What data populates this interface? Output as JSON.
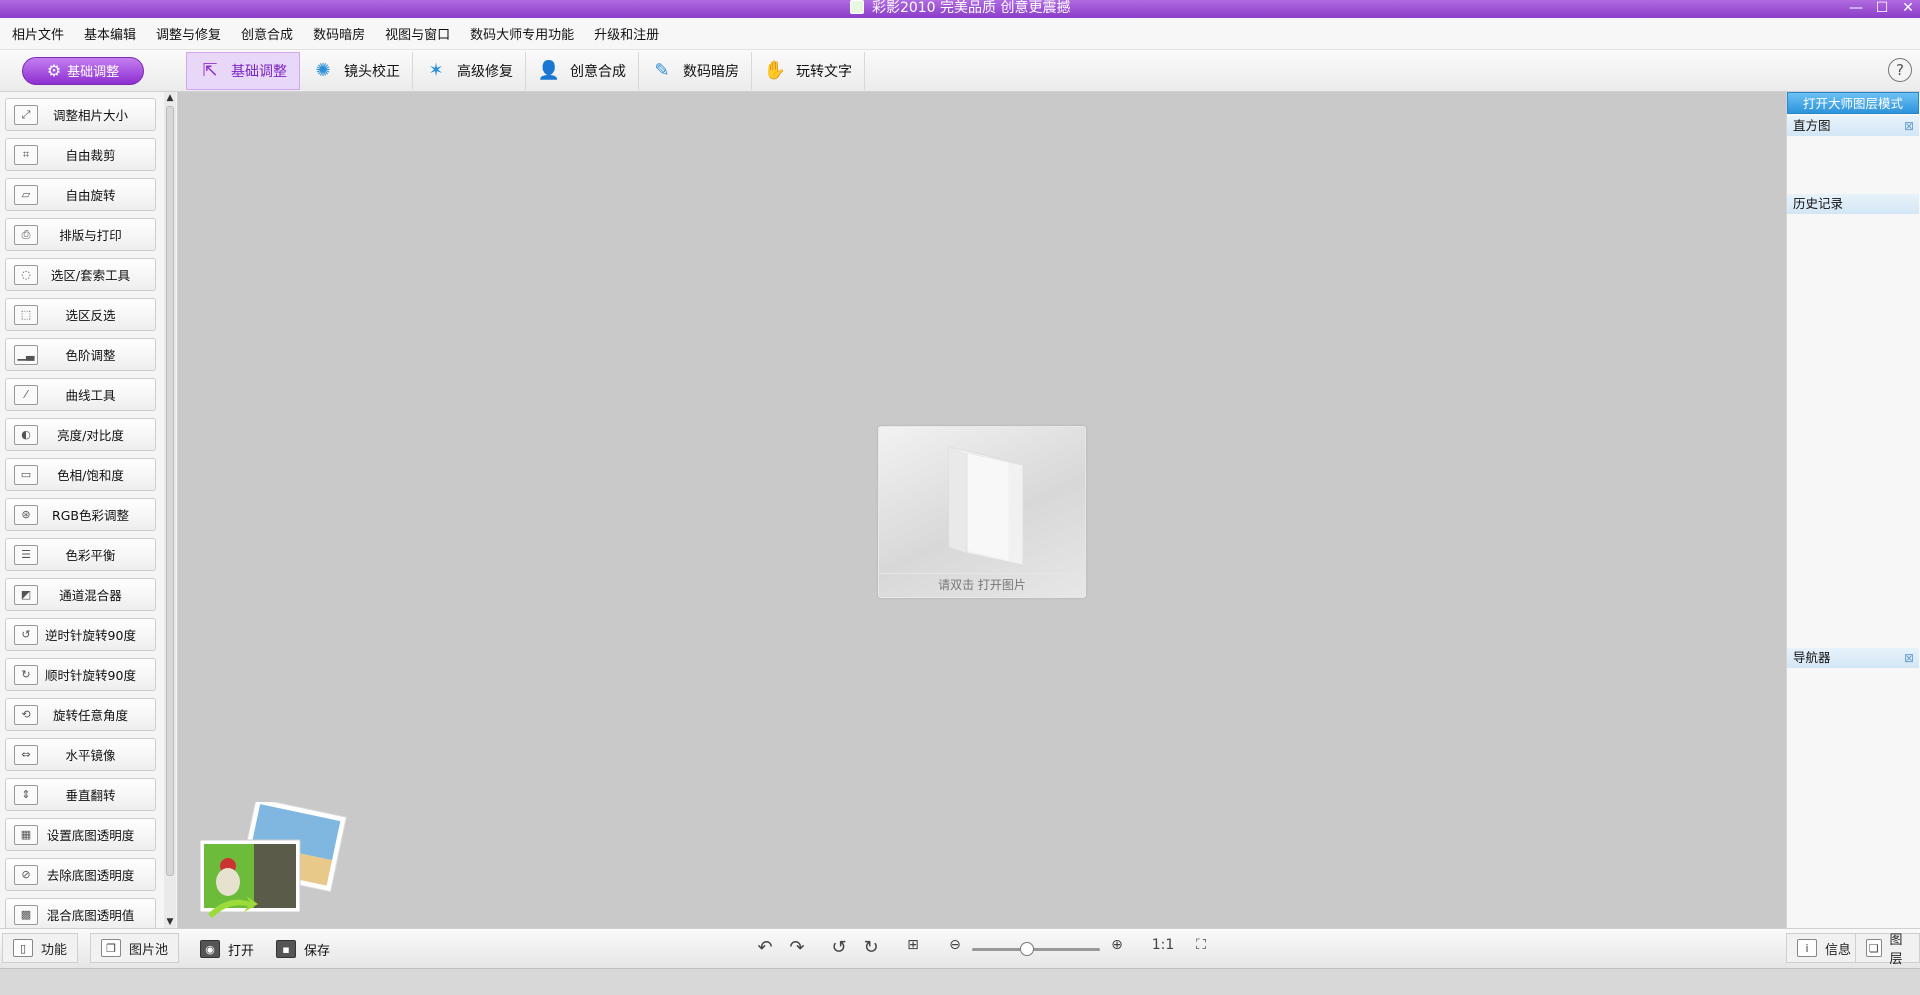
{
  "window": {
    "title": "彩影2010  完美品质  创意更震撼",
    "controls": [
      "—",
      "☐",
      "✕"
    ]
  },
  "menu": [
    "相片文件",
    "基本编辑",
    "调整与修复",
    "创意合成",
    "数码暗房",
    "视图与窗口",
    "数码大师专用功能",
    "升级和注册"
  ],
  "toolbar": {
    "mode_label": "基础调整",
    "tabs": [
      "基础调整",
      "镜头校正",
      "高级修复",
      "创意合成",
      "数码暗房",
      "玩转文字"
    ],
    "help": "?"
  },
  "tools": [
    "调整相片大小",
    "自由裁剪",
    "自由旋转",
    "排版与打印",
    "选区/套索工具",
    "选区反选",
    "色阶调整",
    "曲线工具",
    "亮度/对比度",
    "色相/饱和度",
    "RGB色彩调整",
    "色彩平衡",
    "通道混合器",
    "逆时针旋转90度",
    "顺时针旋转90度",
    "旋转任意角度",
    "水平镜像",
    "垂直翻转",
    "设置底图透明度",
    "去除底图透明度",
    "混合底图透明值"
  ],
  "canvas": {
    "hint": "请双击  打开图片"
  },
  "right_panel": {
    "master_button": "打开大师图层模式",
    "histogram": "直方图",
    "history": "历史记录",
    "navigator": "导航器"
  },
  "bottom": {
    "function_tab": "功能",
    "pool_tab": "图片池",
    "open": "打开",
    "save": "保存",
    "zoom_ratio": "1:1",
    "zoom_level": 0.42,
    "info_tab": "信息",
    "layers_tab": "图层"
  },
  "colors": {
    "accent_purple": "#8d2fd0",
    "accent_blue": "#2c93dc"
  }
}
